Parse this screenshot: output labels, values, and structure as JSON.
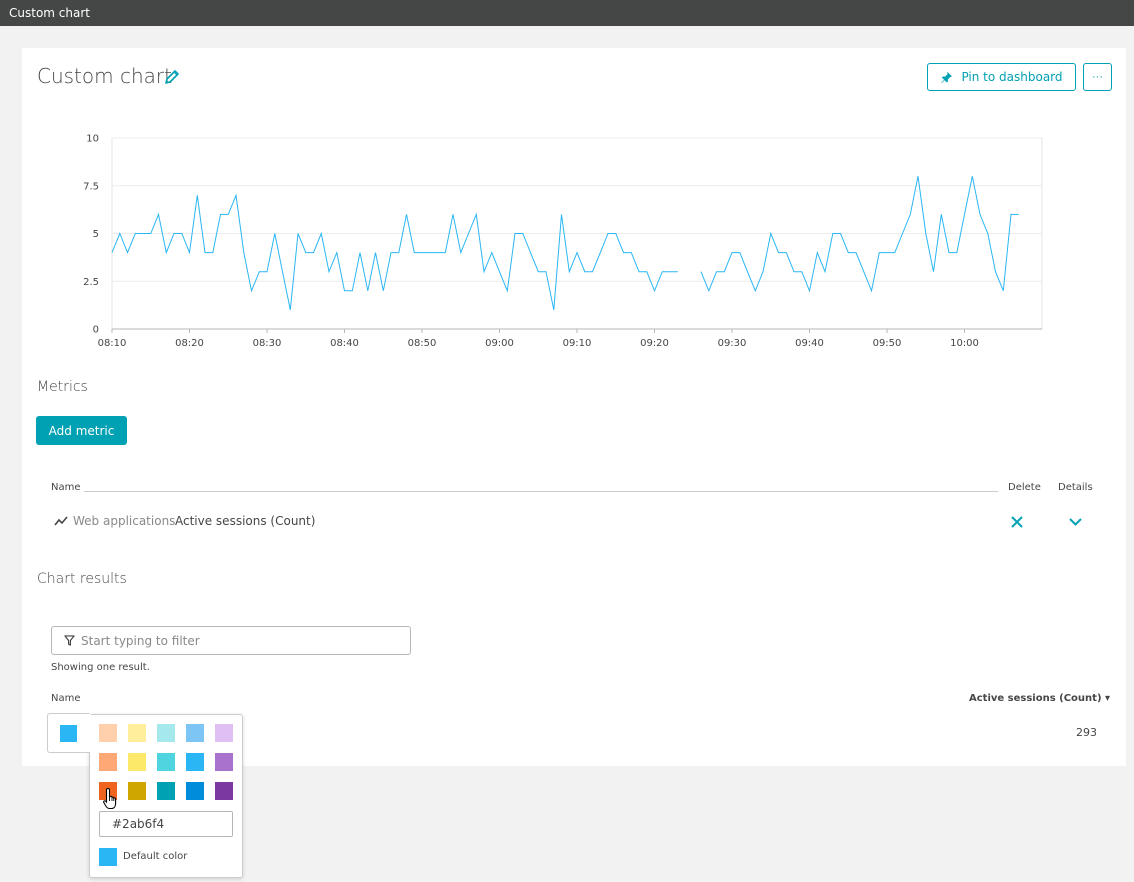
{
  "window": {
    "title": "Custom chart"
  },
  "header": {
    "title": "Custom chart",
    "pin_label": "Pin to dashboard",
    "more_label": "···"
  },
  "chart_data": {
    "type": "line",
    "title": "",
    "xlabel": "",
    "ylabel": "",
    "ylim": [
      0,
      10
    ],
    "y_ticks": [
      "0",
      "2.5",
      "5",
      "7.5",
      "10"
    ],
    "x_ticks": [
      "08:10",
      "08:20",
      "08:30",
      "08:40",
      "08:50",
      "09:00",
      "09:10",
      "09:20",
      "09:30",
      "09:40",
      "09:50",
      "10:00"
    ],
    "x_start": "08:10",
    "x_end": "10:10",
    "grid": true,
    "series": [
      {
        "color": "#2ab6f4",
        "points": [
          [
            "08:10",
            4
          ],
          [
            "08:11",
            5
          ],
          [
            "08:12",
            4
          ],
          [
            "08:13",
            5
          ],
          [
            "08:14",
            5
          ],
          [
            "08:15",
            5
          ],
          [
            "08:16",
            6
          ],
          [
            "08:17",
            4
          ],
          [
            "08:18",
            5
          ],
          [
            "08:19",
            5
          ],
          [
            "08:20",
            4
          ],
          [
            "08:21",
            7
          ],
          [
            "08:22",
            4
          ],
          [
            "08:23",
            4
          ],
          [
            "08:24",
            6
          ],
          [
            "08:25",
            6
          ],
          [
            "08:26",
            7
          ],
          [
            "08:27",
            4
          ],
          [
            "08:28",
            2
          ],
          [
            "08:29",
            3
          ],
          [
            "08:30",
            3
          ],
          [
            "08:31",
            5
          ],
          [
            "08:32",
            3
          ],
          [
            "08:33",
            1
          ],
          [
            "08:34",
            5
          ],
          [
            "08:35",
            4
          ],
          [
            "08:36",
            4
          ],
          [
            "08:37",
            5
          ],
          [
            "08:38",
            3
          ],
          [
            "08:39",
            4
          ],
          [
            "08:40",
            2
          ],
          [
            "08:41",
            2
          ],
          [
            "08:42",
            4
          ],
          [
            "08:43",
            2
          ],
          [
            "08:44",
            4
          ],
          [
            "08:45",
            2
          ],
          [
            "08:46",
            4
          ],
          [
            "08:47",
            4
          ],
          [
            "08:48",
            6
          ],
          [
            "08:49",
            4
          ],
          [
            "08:50",
            4
          ],
          [
            "08:51",
            4
          ],
          [
            "08:52",
            4
          ],
          [
            "08:53",
            4
          ],
          [
            "08:54",
            6
          ],
          [
            "08:55",
            4
          ],
          [
            "08:56",
            5
          ],
          [
            "08:57",
            6
          ],
          [
            "08:58",
            3
          ],
          [
            "08:59",
            4
          ],
          [
            "09:00",
            3
          ],
          [
            "09:01",
            2
          ],
          [
            "09:02",
            5
          ],
          [
            "09:03",
            5
          ],
          [
            "09:04",
            4
          ],
          [
            "09:05",
            3
          ],
          [
            "09:06",
            3
          ],
          [
            "09:07",
            1
          ],
          [
            "09:08",
            6
          ],
          [
            "09:09",
            3
          ],
          [
            "09:10",
            4
          ],
          [
            "09:11",
            3
          ],
          [
            "09:12",
            3
          ],
          [
            "09:13",
            4
          ],
          [
            "09:14",
            5
          ],
          [
            "09:15",
            5
          ],
          [
            "09:16",
            4
          ],
          [
            "09:17",
            4
          ],
          [
            "09:18",
            3
          ],
          [
            "09:19",
            3
          ],
          [
            "09:20",
            2
          ],
          [
            "09:21",
            3
          ],
          [
            "09:22",
            3
          ],
          [
            "09:23",
            3
          ],
          null,
          [
            "09:26",
            3
          ],
          [
            "09:27",
            2
          ],
          [
            "09:28",
            3
          ],
          [
            "09:29",
            3
          ],
          [
            "09:30",
            4
          ],
          [
            "09:31",
            4
          ],
          [
            "09:32",
            3
          ],
          [
            "09:33",
            2
          ],
          [
            "09:34",
            3
          ],
          [
            "09:35",
            5
          ],
          [
            "09:36",
            4
          ],
          [
            "09:37",
            4
          ],
          [
            "09:38",
            3
          ],
          [
            "09:39",
            3
          ],
          [
            "09:40",
            2
          ],
          [
            "09:41",
            4
          ],
          [
            "09:42",
            3
          ],
          [
            "09:43",
            5
          ],
          [
            "09:44",
            5
          ],
          [
            "09:45",
            4
          ],
          [
            "09:46",
            4
          ],
          [
            "09:47",
            3
          ],
          [
            "09:48",
            2
          ],
          [
            "09:49",
            4
          ],
          [
            "09:50",
            4
          ],
          [
            "09:51",
            4
          ],
          [
            "09:52",
            5
          ],
          [
            "09:53",
            6
          ],
          [
            "09:54",
            8
          ],
          [
            "09:55",
            5
          ],
          [
            "09:56",
            3
          ],
          [
            "09:57",
            6
          ],
          [
            "09:58",
            4
          ],
          [
            "09:59",
            4
          ],
          [
            "10:00",
            6
          ],
          [
            "10:01",
            8
          ],
          [
            "10:02",
            6
          ],
          [
            "10:03",
            5
          ],
          [
            "10:04",
            3
          ],
          [
            "10:05",
            2
          ],
          [
            "10:06",
            6
          ],
          [
            "10:07",
            6
          ]
        ]
      }
    ]
  },
  "metrics": {
    "title": "Metrics",
    "add_label": "Add metric",
    "columns": {
      "name": "Name",
      "delete": "Delete",
      "details": "Details"
    },
    "rows": [
      {
        "source": "Web applications",
        "metric": "Active sessions (Count)"
      }
    ]
  },
  "results": {
    "title": "Chart results",
    "filter_placeholder": "Start typing to filter",
    "count_text": "Showing one result.",
    "columns": {
      "name": "Name",
      "value": "Active sessions (Count) ▾"
    },
    "rows": [
      {
        "value": "293",
        "color": "#2ab6f4"
      }
    ]
  },
  "color_picker": {
    "current": "#2ab6f4",
    "palette": [
      [
        "#ffd0ab",
        "#ffee9c",
        "#a6e9ed",
        "#7dc5f5",
        "#e0bff5"
      ],
      [
        "#fea876",
        "#fde969",
        "#4fd5e0",
        "#2ab6f4",
        "#a972cc"
      ],
      [
        "#ef651f",
        "#cfa500",
        "#00a1b2",
        "#008cdb",
        "#7c38a1"
      ]
    ],
    "hex_value": "#2ab6f4",
    "default_label": "Default color",
    "default_color": "#2ab6f4"
  }
}
